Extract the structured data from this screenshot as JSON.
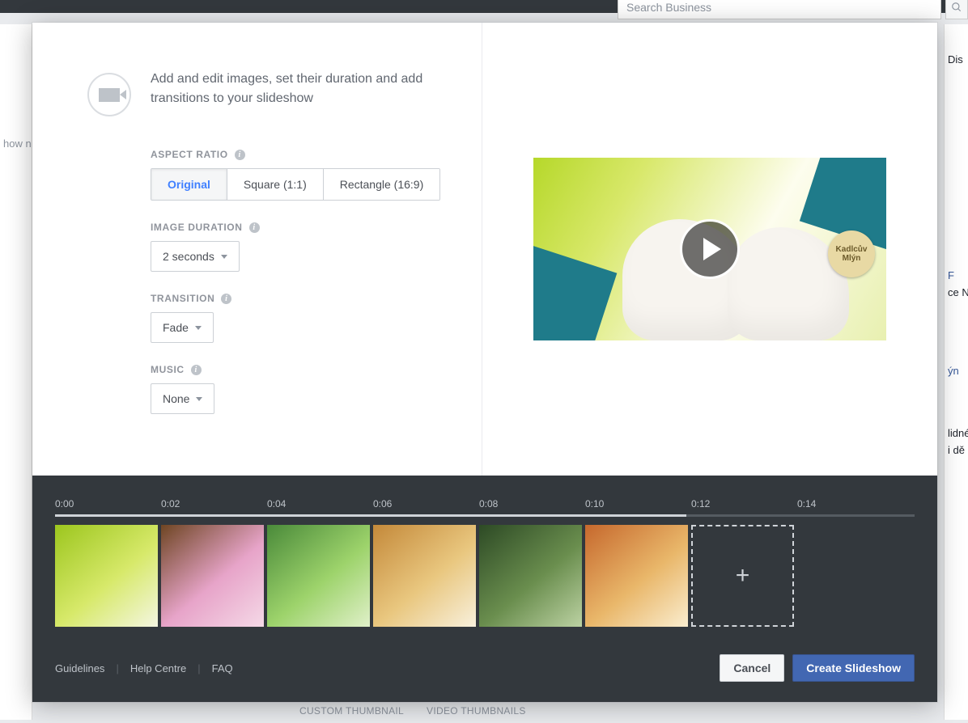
{
  "background": {
    "search_placeholder": "Search Business",
    "discard": "Dis",
    "sidebar_items": [
      "F",
      "ce Net",
      "ýn",
      "lidné",
      "i dě"
    ],
    "how_n": "how n",
    "bottom_tabs": [
      "CUSTOM THUMBNAIL",
      "VIDEO THUMBNAILS"
    ]
  },
  "intro": "Add and edit images, set their duration and add transitions to your slideshow",
  "labels": {
    "aspect_ratio": "ASPECT RATIO",
    "image_duration": "IMAGE DURATION",
    "transition": "TRANSITION",
    "music": "MUSIC"
  },
  "aspect_ratio": {
    "options": [
      "Original",
      "Square (1:1)",
      "Rectangle (16:9)"
    ],
    "selected": "Original"
  },
  "image_duration": {
    "value": "2 seconds"
  },
  "transition": {
    "value": "Fade"
  },
  "music": {
    "value": "None"
  },
  "preview": {
    "badge_top": "Kadlcův",
    "badge_bottom": "Mlýn"
  },
  "timeline": {
    "ticks": [
      "0:00",
      "0:02",
      "0:04",
      "0:06",
      "0:08",
      "0:10",
      "0:12",
      "0:14"
    ],
    "add": "+"
  },
  "footer": {
    "links": [
      "Guidelines",
      "Help Centre",
      "FAQ"
    ],
    "cancel": "Cancel",
    "create": "Create Slideshow"
  }
}
